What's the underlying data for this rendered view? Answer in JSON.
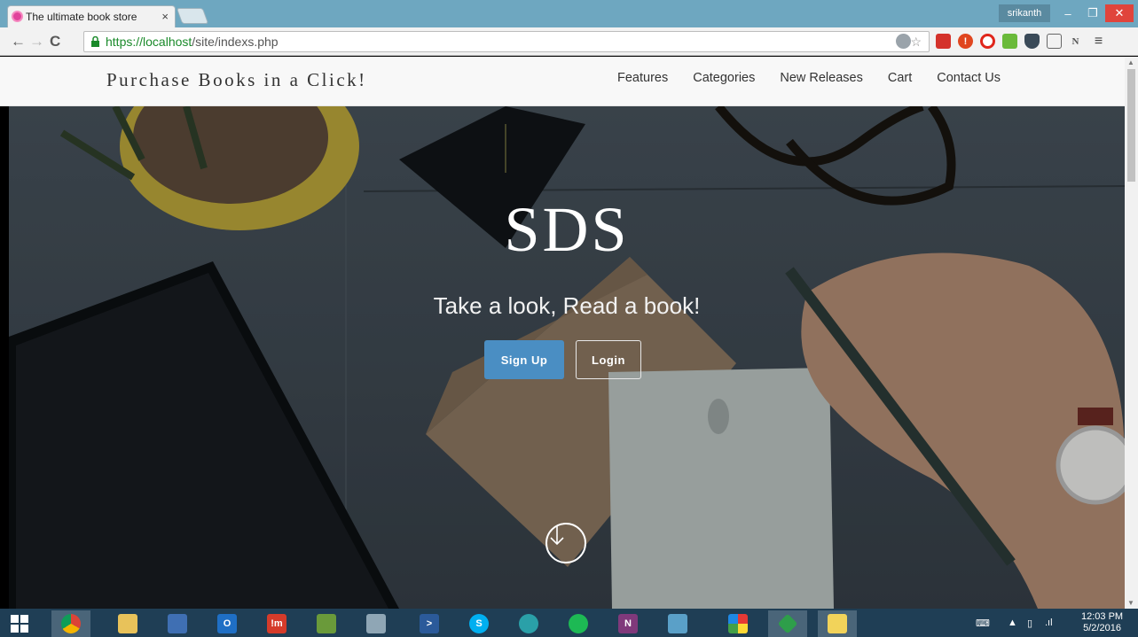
{
  "browser": {
    "tab_title": "The ultimate book store",
    "tab_close": "×",
    "profile_name": "srikanth",
    "url_secure_part": "https://localhost",
    "url_path": "/site/indexs.php",
    "window_controls": {
      "minimize": "–",
      "restore": "❐",
      "close": "✕"
    }
  },
  "site": {
    "brand": "Purchase Books in a Click!",
    "menu": [
      "Features",
      "Categories",
      "New Releases",
      "Cart",
      "Contact Us"
    ]
  },
  "hero": {
    "title": "SDS",
    "subtitle": "Take a look, Read a book!",
    "signup_label": "Sign Up",
    "login_label": "Login"
  },
  "taskbar": {
    "clock_time": "12:03 PM",
    "clock_date": "5/2/2016",
    "apps": [
      "chrome-icon",
      "file-explorer-icon",
      "network-icon",
      "outlook-icon",
      "im-icon",
      "project-icon",
      "calculator-icon",
      "powershell-icon",
      "skype-icon",
      "browser-icon",
      "spotify-icon",
      "onenote-icon",
      "remote-icon",
      "color-app-icon",
      "green-app-icon",
      "yellow-app-icon"
    ]
  },
  "colors": {
    "titlebar": "#6ea7c0",
    "signup_button": "#4a8ec3",
    "taskbar": "#1f3e55",
    "url_secure": "#1a8a2a"
  }
}
